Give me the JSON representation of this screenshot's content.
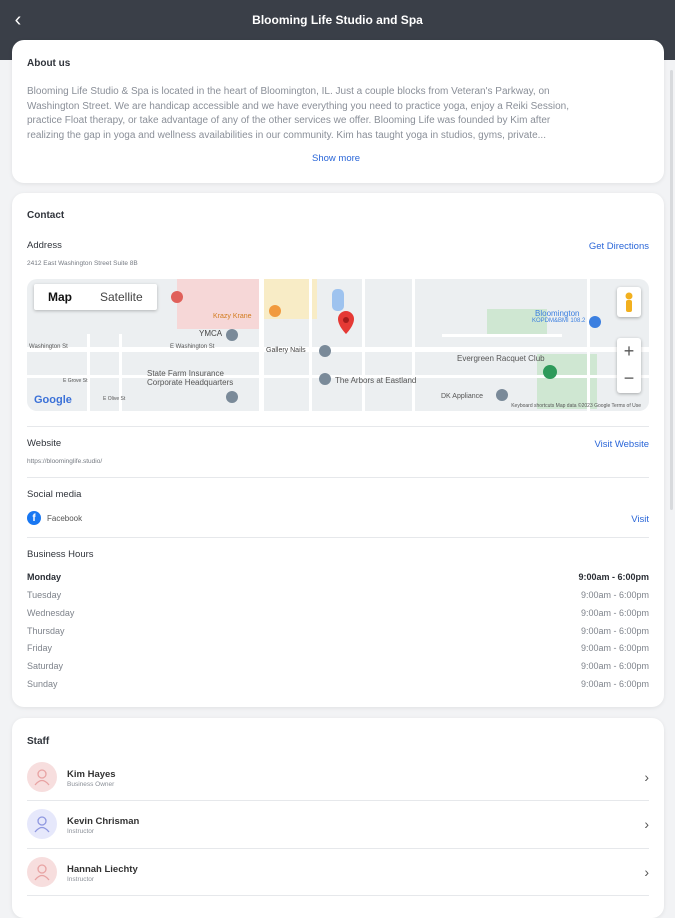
{
  "header": {
    "title": "Blooming Life Studio and Spa"
  },
  "about": {
    "heading": "About us",
    "lines": [
      "Blooming Life Studio & Spa is located in the heart of Bloomington, IL.  Just a couple blocks from Veteran's Parkway, on",
      "Washington Street.  We are handicap accessible and we have everything you need to practice yoga, enjoy a Reiki Session,",
      "practice Float therapy, or take advantage of any of the other services we offer.   Blooming Life was founded by Kim after",
      "realizing the gap in yoga and wellness availabilities in our community.  Kim has taught yoga in studios, gyms, private..."
    ],
    "show_more": "Show more"
  },
  "contact": {
    "heading": "Contact",
    "address_label": "Address",
    "address": "2412 East Washington Street Suite 8B",
    "directions": "Get Directions",
    "map": {
      "map_tab": "Map",
      "satellite_tab": "Satellite",
      "google": "Google",
      "credits": "Keyboard shortcuts   Map data ©2023 Google   Terms of Use",
      "labels": {
        "ymca": "YMCA",
        "krazy": "Krazy Krane",
        "gallery": "Gallery Nails",
        "state_farm_1": "State Farm Insurance",
        "state_farm_2": "Corporate Headquarters",
        "arbors": "The Arbors at Eastland",
        "evergreen": "Evergreen Racquet Club",
        "dk": "DK Appliance",
        "bloom_1": "Bloomington",
        "bloom_2": "KOPDM&BMI 108.2",
        "washington": "Washington St",
        "e_washington": "E Washington St",
        "grove": "E Grove St",
        "olive": "E Olive St"
      }
    },
    "website_label": "Website",
    "website": "https://bloominglife.studio/",
    "visit_website": "Visit Website",
    "social_label": "Social media",
    "facebook": "Facebook",
    "visit": "Visit",
    "hours_label": "Business Hours",
    "hours": [
      {
        "day": "Monday",
        "time": "9:00am - 6:00pm"
      },
      {
        "day": "Tuesday",
        "time": "9:00am - 6:00pm"
      },
      {
        "day": "Wednesday",
        "time": "9:00am - 6:00pm"
      },
      {
        "day": "Thursday",
        "time": "9:00am - 6:00pm"
      },
      {
        "day": "Friday",
        "time": "9:00am - 6:00pm"
      },
      {
        "day": "Saturday",
        "time": "9:00am - 6:00pm"
      },
      {
        "day": "Sunday",
        "time": "9:00am - 6:00pm"
      }
    ]
  },
  "staff": {
    "heading": "Staff",
    "members": [
      {
        "name": "Kim Hayes",
        "role": "Business Owner",
        "avatar_color": "#f7dede"
      },
      {
        "name": "Kevin Chrisman",
        "role": "Instructor",
        "avatar_color": "#e6e8fb"
      },
      {
        "name": "Hannah Liechty",
        "role": "Instructor",
        "avatar_color": "#f7dede"
      }
    ]
  },
  "colors": {
    "accent": "#2a66d8",
    "header_bg": "#3a3f48"
  }
}
